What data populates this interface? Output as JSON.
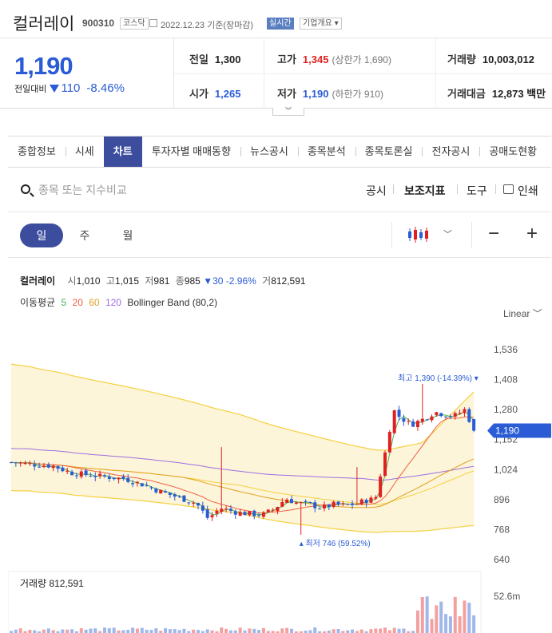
{
  "header": {
    "name": "컬러레이",
    "code": "900310",
    "market": "코스닥",
    "date": "2022.12.23  기준(장마감)",
    "realtime": "실시간",
    "company_info": "기업개요 ▾"
  },
  "quote": {
    "price": "1,190",
    "change_label": "전일대비",
    "change_value": "110",
    "change_pct": "-8.46%",
    "prev_close_label": "전일",
    "prev_close": "1,300",
    "high_label": "고가",
    "high": "1,345",
    "upper_limit": "(상한가 1,690)",
    "volume_label": "거래량",
    "volume": "10,003,012",
    "open_label": "시가",
    "open": "1,265",
    "low_label": "저가",
    "low": "1,190",
    "lower_limit": "(하한가 910)",
    "amount_label": "거래대금",
    "amount": "12,873 백만"
  },
  "tabs": [
    "종합정보",
    "시세",
    "차트",
    "투자자별 매매동향",
    "뉴스공시",
    "종목분석",
    "종목토론실",
    "전자공시",
    "공매도현황"
  ],
  "toolbar": {
    "search_placeholder": "종목 또는 지수비교",
    "disclosure": "공시",
    "indicators": "보조지표",
    "tools": "도구",
    "print": "인쇄"
  },
  "period": [
    "일",
    "주",
    "월"
  ],
  "legend": {
    "name": "컬러레이",
    "open_k": "시",
    "open": "1,010",
    "high_k": "고",
    "high": "1,015",
    "low_k": "저",
    "low": "981",
    "close_k": "종",
    "close": "985",
    "change": "▼30 -2.96%",
    "vol_k": "거",
    "volume": "812,591",
    "ma_label": "이동평균",
    "ma5": "5",
    "ma20": "20",
    "ma60": "60",
    "ma120": "120",
    "bb": "Bollinger Band (80,2)"
  },
  "scale_mode": "Linear",
  "colors": {
    "up": "#e02020",
    "down": "#2a5cd6",
    "ma5": "#4caf50",
    "ma20": "#f06040",
    "ma60": "#e0a020",
    "ma120": "#9b6ee0",
    "bb": "#f5d040"
  },
  "chart_data": {
    "type": "candlestick",
    "y_ticks": [
      "1,536",
      "1,408",
      "1,280",
      "1,152",
      "1,024",
      "896",
      "768",
      "640"
    ],
    "y_range": [
      640,
      1536
    ],
    "current_price_label": "1,190",
    "current_price": 1190,
    "max_label": "최고 1,390 (-14.39%) ▾",
    "min_label": "▴ 최저 746 (59.52%)",
    "volume_label": "거래량 812,591",
    "volume_tick": "52.6m"
  }
}
